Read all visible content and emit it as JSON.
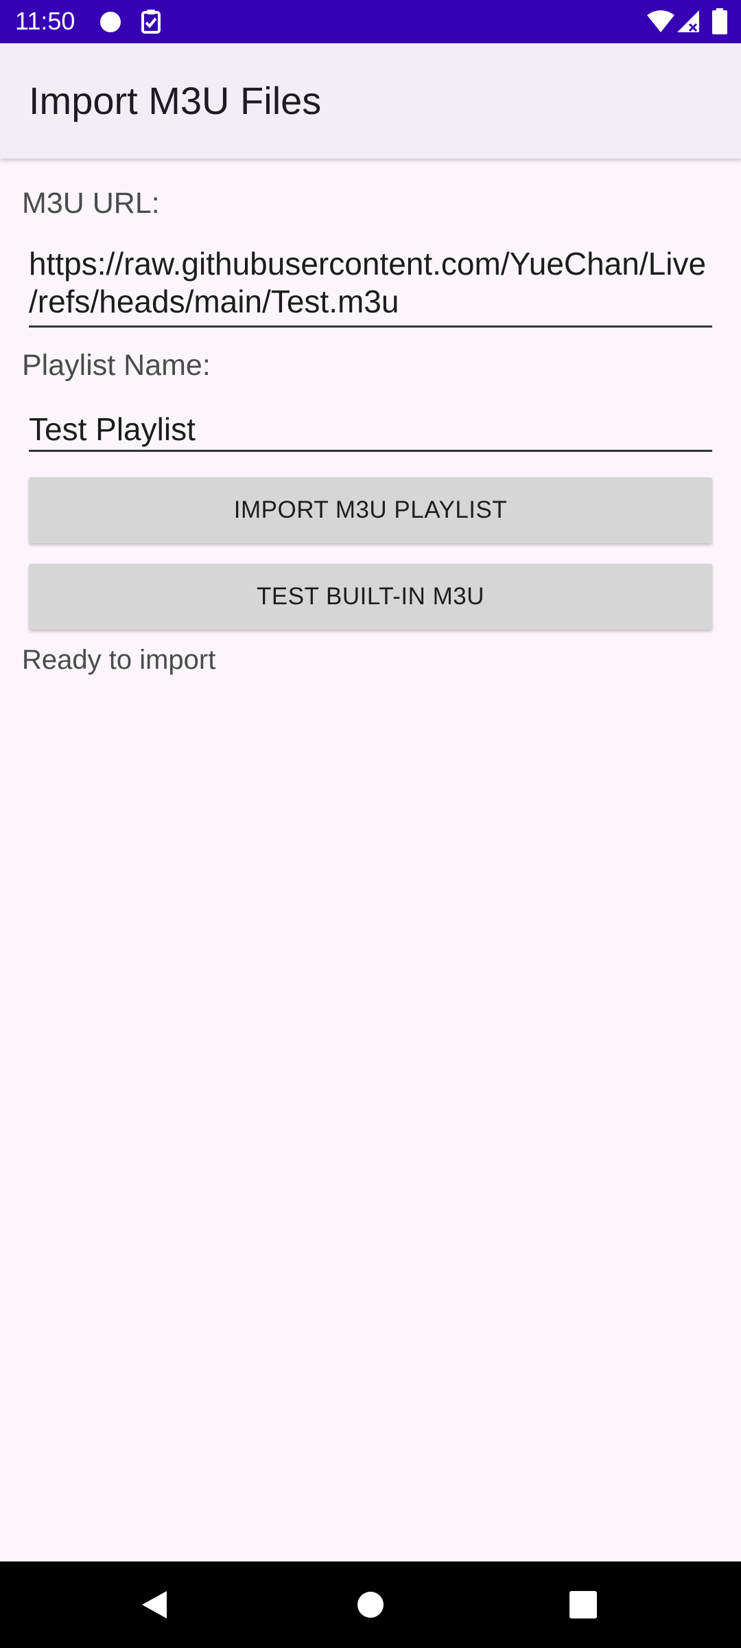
{
  "status_bar": {
    "time": "11:50",
    "background_color": "#3700b3",
    "icons": [
      "circle-notification-icon",
      "clipboard-check-icon",
      "wifi-icon",
      "signal-icon",
      "battery-icon"
    ]
  },
  "app_bar": {
    "title": "Import M3U Files"
  },
  "form": {
    "url_label": "M3U URL:",
    "url_value": "https://raw.githubusercontent.com/YueChan/Live/refs/heads/main/Test.m3u",
    "name_label": "Playlist Name:",
    "name_value": "Test Playlist"
  },
  "buttons": {
    "import_label": "IMPORT M3U PLAYLIST",
    "test_label": "TEST BUILT-IN M3U"
  },
  "status": {
    "message": "Ready to import"
  },
  "nav_bar": {
    "icons": [
      "back-icon",
      "home-icon",
      "recents-icon"
    ]
  }
}
